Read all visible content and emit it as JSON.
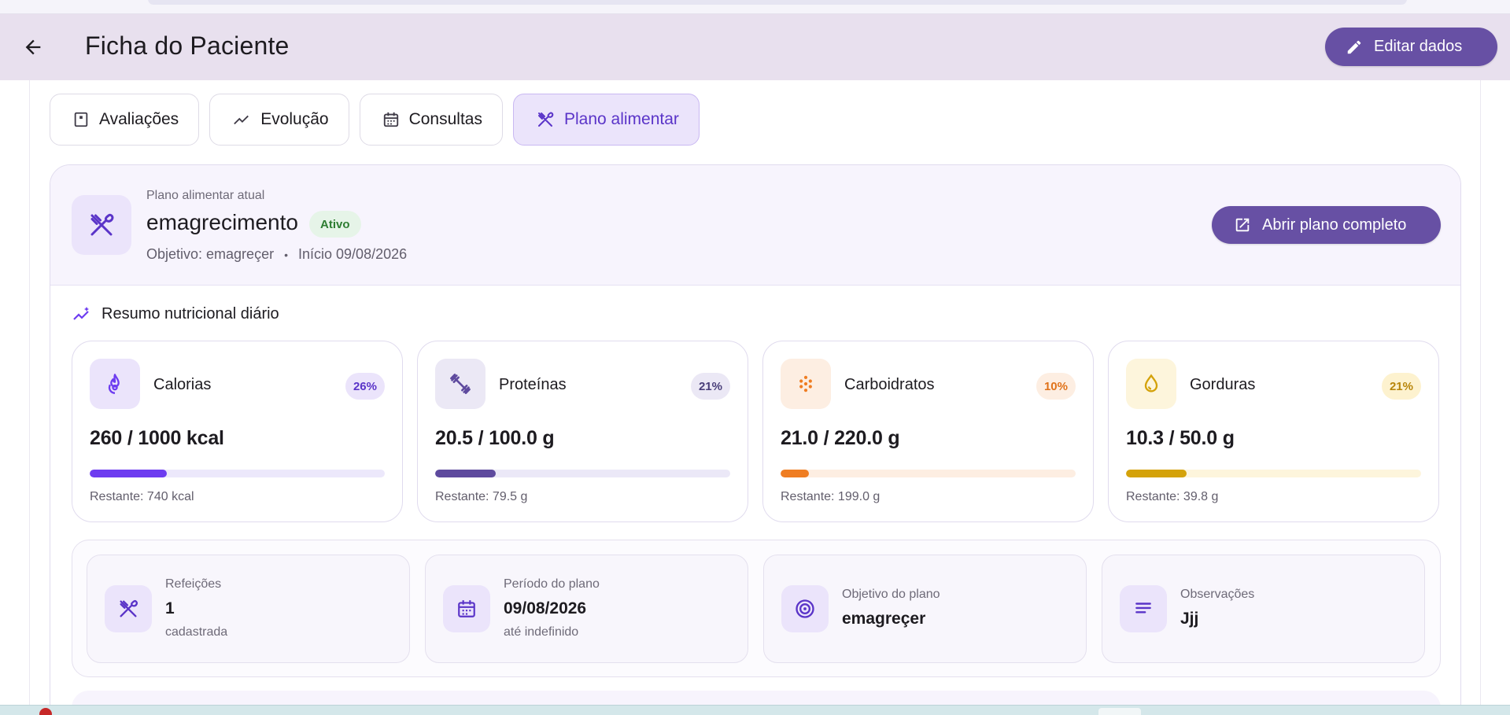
{
  "appbar": {
    "title": "Ficha do Paciente",
    "edit_label": "Editar dados"
  },
  "tabs": [
    {
      "label": "Avaliações",
      "icon": "assessment-icon"
    },
    {
      "label": "Evolução",
      "icon": "trending-up-icon"
    },
    {
      "label": "Consultas",
      "icon": "calendar-icon"
    },
    {
      "label": "Plano alimentar",
      "icon": "utensils-icon",
      "active": true
    }
  ],
  "plan": {
    "section_label": "Plano alimentar atual",
    "name": "emagrecimento",
    "status": "Ativo",
    "objective": "Objetivo: emagreçer",
    "separator": "•",
    "start": "Início 09/08/2026",
    "open_label": "Abrir plano completo"
  },
  "summary": {
    "title": "Resumo nutricional diário",
    "macros": [
      {
        "name": "Calorias",
        "pct": "26%",
        "progress": 0.26,
        "value": "260 / 1000 kcal",
        "rest": "Restante: 740 kcal",
        "icon": "flame-icon",
        "color": "#6d3cf0",
        "track": "#ece8fb",
        "iconbg": "#ebe4fb",
        "badgebg": "#ebe4fb",
        "badgefg": "#5a34c8"
      },
      {
        "name": "Proteínas",
        "pct": "21%",
        "progress": 0.205,
        "value": "20.5 / 100.0 g",
        "rest": "Restante: 79.5 g",
        "icon": "dumbbell-icon",
        "color": "#5e4a9e",
        "track": "#ebe8f7",
        "iconbg": "#ebe8f5",
        "badgebg": "#ebe8f5",
        "badgefg": "#4a3f7a"
      },
      {
        "name": "Carboidratos",
        "pct": "10%",
        "progress": 0.095,
        "value": "21.0 / 220.0 g",
        "rest": "Restante: 199.0 g",
        "icon": "grain-icon",
        "color": "#ef7d22",
        "track": "#fdeee2",
        "iconbg": "#fdeee2",
        "badgebg": "#fdeee2",
        "badgefg": "#e0721a"
      },
      {
        "name": "Gorduras",
        "pct": "21%",
        "progress": 0.206,
        "value": "10.3 / 50.0 g",
        "rest": "Restante: 39.8 g",
        "icon": "drop-icon",
        "color": "#d4a20a",
        "track": "#fdf5dc",
        "iconbg": "#fdf5dc",
        "badgebg": "#fdf2cf",
        "badgefg": "#b8860b"
      }
    ]
  },
  "info": [
    {
      "label": "Refeições",
      "value": "1",
      "sub": "cadastrada",
      "icon": "utensils-icon"
    },
    {
      "label": "Período do plano",
      "value": "09/08/2026",
      "sub": "até indefinido",
      "icon": "calendar-icon"
    },
    {
      "label": "Objetivo do plano",
      "value": "emagreçer",
      "sub": "",
      "icon": "target-icon"
    },
    {
      "label": "Observações",
      "value": "Jjj",
      "sub": "",
      "icon": "notes-icon"
    }
  ]
}
